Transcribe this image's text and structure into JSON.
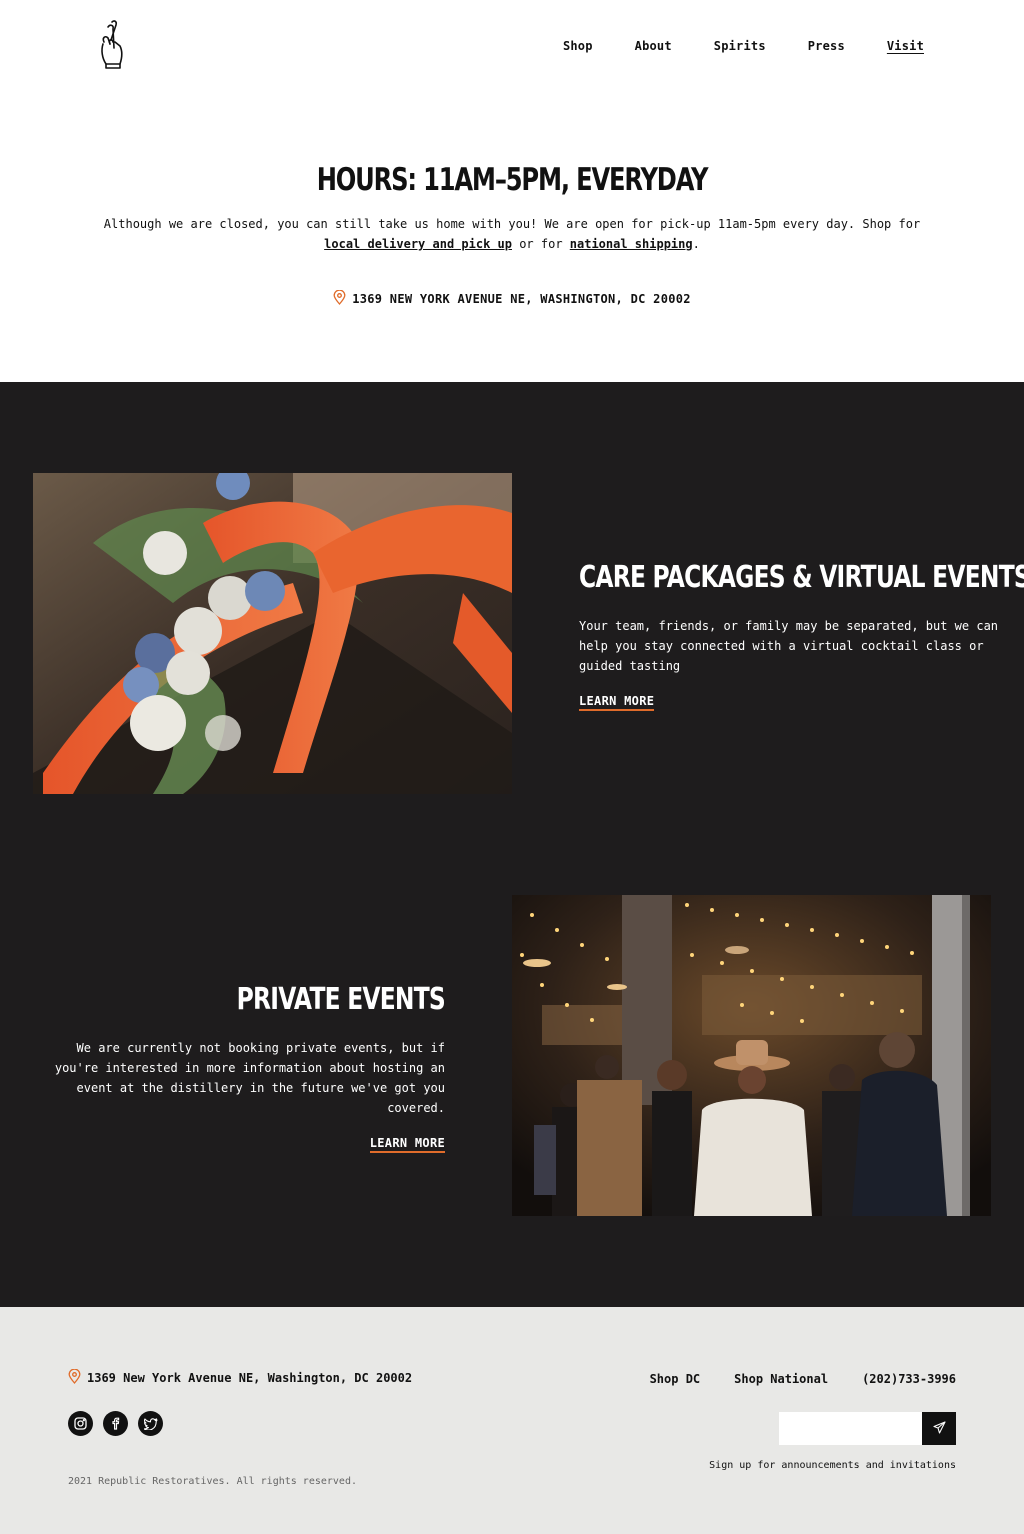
{
  "header": {
    "logo_icon": "crossed-fingers-icon",
    "nav": [
      {
        "label": "Shop"
      },
      {
        "label": "About"
      },
      {
        "label": "Spirits"
      },
      {
        "label": "Press"
      },
      {
        "label": "Visit",
        "active": true
      }
    ]
  },
  "hours": {
    "title": "HOURS: 11AM–5PM, EVERYDAY",
    "text_before": "Although we are closed, you can still take us home with you! We are open for pick-up 11am-5pm every day. Shop for ",
    "link_local": "local delivery and pick up",
    "text_middle": " or for ",
    "link_national": "national shipping",
    "text_after": ".",
    "address": "1369 NEW YORK AVENUE NE, WASHINGTON, DC 20002",
    "address_icon": "map-pin-icon"
  },
  "features": {
    "care": {
      "title": "CARE PACKAGES & VIRTUAL EVENTS",
      "text": "Your team, friends, or family may be separated, but we can help you stay connected with a virtual cocktail class or guided tasting",
      "link": "LEARN MORE"
    },
    "private": {
      "title": "PRIVATE EVENTS",
      "text": "We are currently not booking private events, but if you're interested in more information about hosting an event at the distillery in the future we've got you covered.",
      "link": "LEARN MORE"
    }
  },
  "footer": {
    "address": "1369 New York Avenue NE, Washington, DC 20002",
    "socials": [
      "instagram-icon",
      "facebook-icon",
      "twitter-icon"
    ],
    "copyright": "2021 Republic Restoratives. All rights reserved.",
    "links": [
      "Shop DC",
      "Shop National",
      "(202)733-3996"
    ],
    "signup_placeholder": "",
    "signup_text": "Sign up for announcements and invitations"
  },
  "colors": {
    "accent": "#e06c2b",
    "dark_bg": "#1e1c1d",
    "footer_bg": "#e8e8e6"
  }
}
